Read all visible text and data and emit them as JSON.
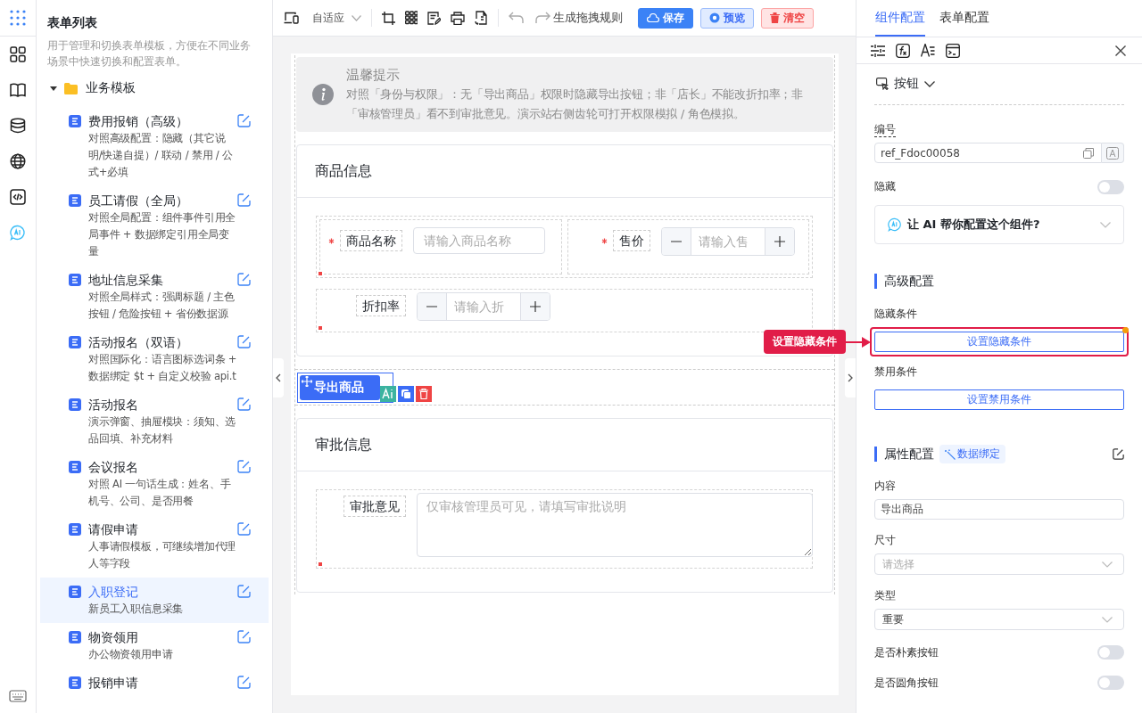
{
  "left_panel": {
    "title": "表单列表",
    "description": "用于管理和切换表单模板，方便在不同业务场景中快速切换和配置表单。",
    "folder": {
      "label": "业务模板",
      "expanded": true,
      "children": [
        {
          "title": "费用报销（高级）",
          "description": "对照高级配置：隐藏（其它说明/快递自提）/ 联动 / 禁用 / 公式+必填",
          "selected": false
        },
        {
          "title": "员工请假（全局）",
          "description": "对照全局配置：组件事件引用全局事件 + 数据绑定引用全局变量",
          "selected": false
        },
        {
          "title": "地址信息采集",
          "description": "对照全局样式：强调标题 / 主色按钮 / 危险按钮 + 省份数据源",
          "selected": false
        },
        {
          "title": "活动报名（双语）",
          "description": "对照国际化：语言图标选词条 + 数据绑定 $t + 自定义校验 api.t",
          "selected": false
        },
        {
          "title": "活动报名",
          "description": "演示弹窗、抽屉模块：须知、选品回填、补充材料",
          "selected": false
        },
        {
          "title": "会议报名",
          "description": "对照 AI 一句话生成：姓名、手机号、公司、是否用餐",
          "selected": false
        },
        {
          "title": "请假申请",
          "description": "人事请假模板，可继续增加代理人等字段",
          "selected": false
        },
        {
          "title": "入职登记",
          "description": "新员工入职信息采集",
          "selected": true
        },
        {
          "title": "物资领用",
          "description": "办公物资领用申请",
          "selected": false
        },
        {
          "title": "报销申请",
          "selected": false
        }
      ]
    }
  },
  "toolbar": {
    "device_mode": "自适应",
    "rule_label": "生成拖拽规则",
    "buttons": [
      {
        "label": "保存",
        "kind": "primary"
      },
      {
        "label": "预览",
        "kind": "secondary"
      },
      {
        "label": "清空",
        "kind": "danger"
      }
    ]
  },
  "canvas": {
    "tip": {
      "title": "温馨提示",
      "text": "对照「身份与权限」：无「导出商品」权限时隐藏导出按钮；非「店长」不能改折扣率；非「审核管理员」看不到审批意见。演示站右侧齿轮可打开权限模拟 / 角色模拟。"
    },
    "blocks": [
      {
        "kind": "card",
        "title": "商品信息",
        "rows": [
          [
            {
              "kind": "input",
              "label": "商品名称",
              "placeholder": "请输入商品名称",
              "required": true
            },
            {
              "kind": "number",
              "label": "售价",
              "placeholder": "请输入售",
              "required": true
            }
          ],
          [
            {
              "kind": "number",
              "label": "折扣率",
              "placeholder": "请输入折",
              "required": false
            }
          ]
        ]
      },
      {
        "kind": "button",
        "label": "导出商品",
        "selected": true
      },
      {
        "kind": "card",
        "title": "审批信息",
        "rows": [
          [
            {
              "kind": "textarea",
              "label": "审批意见",
              "placeholder": "仅审核管理员可见，请填写审批说明",
              "required": false
            }
          ]
        ]
      }
    ]
  },
  "callout": {
    "text": "设置隐藏条件"
  },
  "config_panel": {
    "tabs": [
      {
        "label": "组件配置",
        "selected": true
      },
      {
        "label": "表单配置",
        "selected": false
      }
    ],
    "component_type": "按钮",
    "id_field": {
      "label": "编号",
      "value": "ref_Fdoc00058"
    },
    "hidden_toggle": {
      "label": "隐藏",
      "on": false
    },
    "ai_assist": {
      "text": "让 AI 帮你配置这个组件?",
      "expanded": false
    },
    "advanced": {
      "title": "高级配置",
      "conditions": [
        {
          "label": "隐藏条件",
          "button": "设置隐藏条件",
          "highlighted": true
        },
        {
          "label": "禁用条件",
          "button": "设置禁用条件",
          "highlighted": false
        }
      ]
    },
    "properties": {
      "title": "属性配置",
      "binding_tag": "数据绑定",
      "fields": [
        {
          "kind": "input",
          "label": "内容",
          "value": "导出商品"
        },
        {
          "kind": "select",
          "label": "尺寸",
          "placeholder": "请选择"
        },
        {
          "kind": "select",
          "label": "类型",
          "value": "重要"
        },
        {
          "kind": "toggle",
          "label": "是否朴素按钮",
          "on": false
        },
        {
          "kind": "toggle",
          "label": "是否圆角按钮",
          "on": false
        }
      ]
    }
  }
}
